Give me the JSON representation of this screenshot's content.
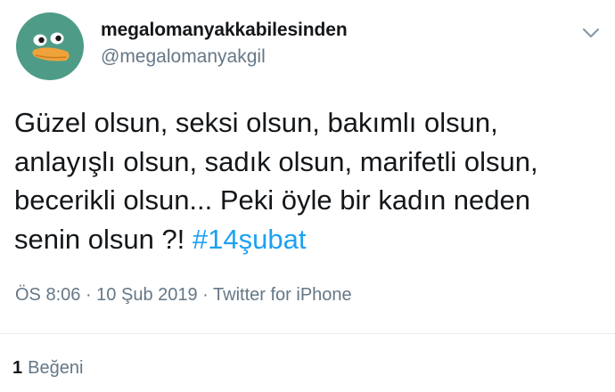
{
  "user": {
    "display_name": "megalomanyakkabilesinden",
    "handle": "@megalomanyakgil",
    "avatar_icon": "duck-face-icon",
    "avatar_color": "#4e9c87"
  },
  "menu_icon": "chevron-down-icon",
  "tweet": {
    "text": "Güzel olsun, seksi olsun, bakımlı olsun, anlayışlı olsun, sadık olsun, marifetli olsun, becerikli olsun... Peki öyle bir kadın neden senin olsun ?! ",
    "hashtag": "#14şubat",
    "hashtag_color": "#1da1f2"
  },
  "meta": {
    "time": "ÖS 8:06",
    "separator": " · ",
    "date": "10 Şub 2019",
    "source": "Twitter for iPhone"
  },
  "stats": {
    "like_count": "1",
    "like_label": "Beğeni"
  }
}
